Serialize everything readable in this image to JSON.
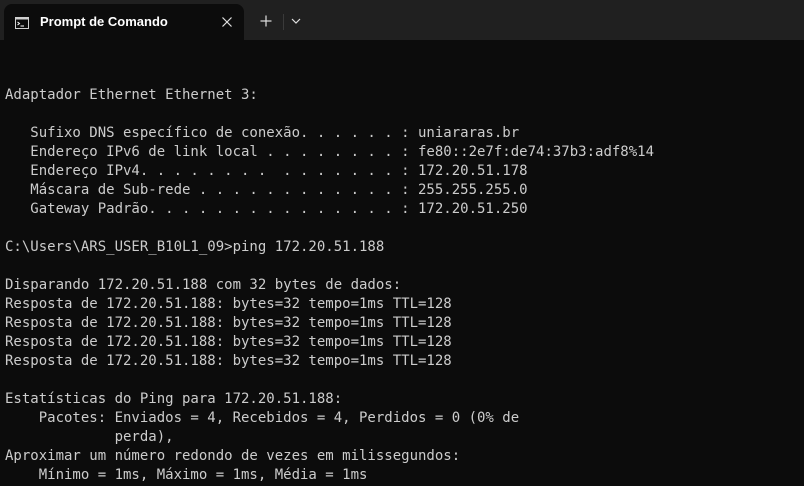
{
  "window": {
    "tab": {
      "title": "Prompt de Comando",
      "icon": "command-prompt-icon"
    },
    "controls": {
      "close_icon": "close-icon",
      "new_tab_icon": "plus-icon",
      "dropdown_icon": "chevron-down-icon"
    }
  },
  "terminal": {
    "lines": [
      "Adaptador Ethernet Ethernet 3:",
      "",
      "   Sufixo DNS específico de conexão. . . . . . : uniararas.br",
      "   Endereço IPv6 de link local . . . . . . . . : fe80::2e7f:de74:37b3:adf8%14",
      "   Endereço IPv4. . . . . . . .  . . . . . . . : 172.20.51.178",
      "   Máscara de Sub-rede . . . . . . . . . . . . : 255.255.255.0",
      "   Gateway Padrão. . . . . . . . . . . . . . . : 172.20.51.250",
      "",
      "C:\\Users\\ARS_USER_B10L1_09>ping 172.20.51.188",
      "",
      "Disparando 172.20.51.188 com 32 bytes de dados:",
      "Resposta de 172.20.51.188: bytes=32 tempo=1ms TTL=128",
      "Resposta de 172.20.51.188: bytes=32 tempo=1ms TTL=128",
      "Resposta de 172.20.51.188: bytes=32 tempo=1ms TTL=128",
      "Resposta de 172.20.51.188: bytes=32 tempo=1ms TTL=128",
      "",
      "Estatísticas do Ping para 172.20.51.188:",
      "    Pacotes: Enviados = 4, Recebidos = 4, Perdidos = 0 (0% de",
      "             perda),",
      "Aproximar um número redondo de vezes em milissegundos:",
      "    Mínimo = 1ms, Máximo = 1ms, Média = 1ms"
    ]
  },
  "colors": {
    "tabbar_background": "#202020",
    "terminal_background": "#0c0c0c",
    "text": "#cccccc"
  }
}
